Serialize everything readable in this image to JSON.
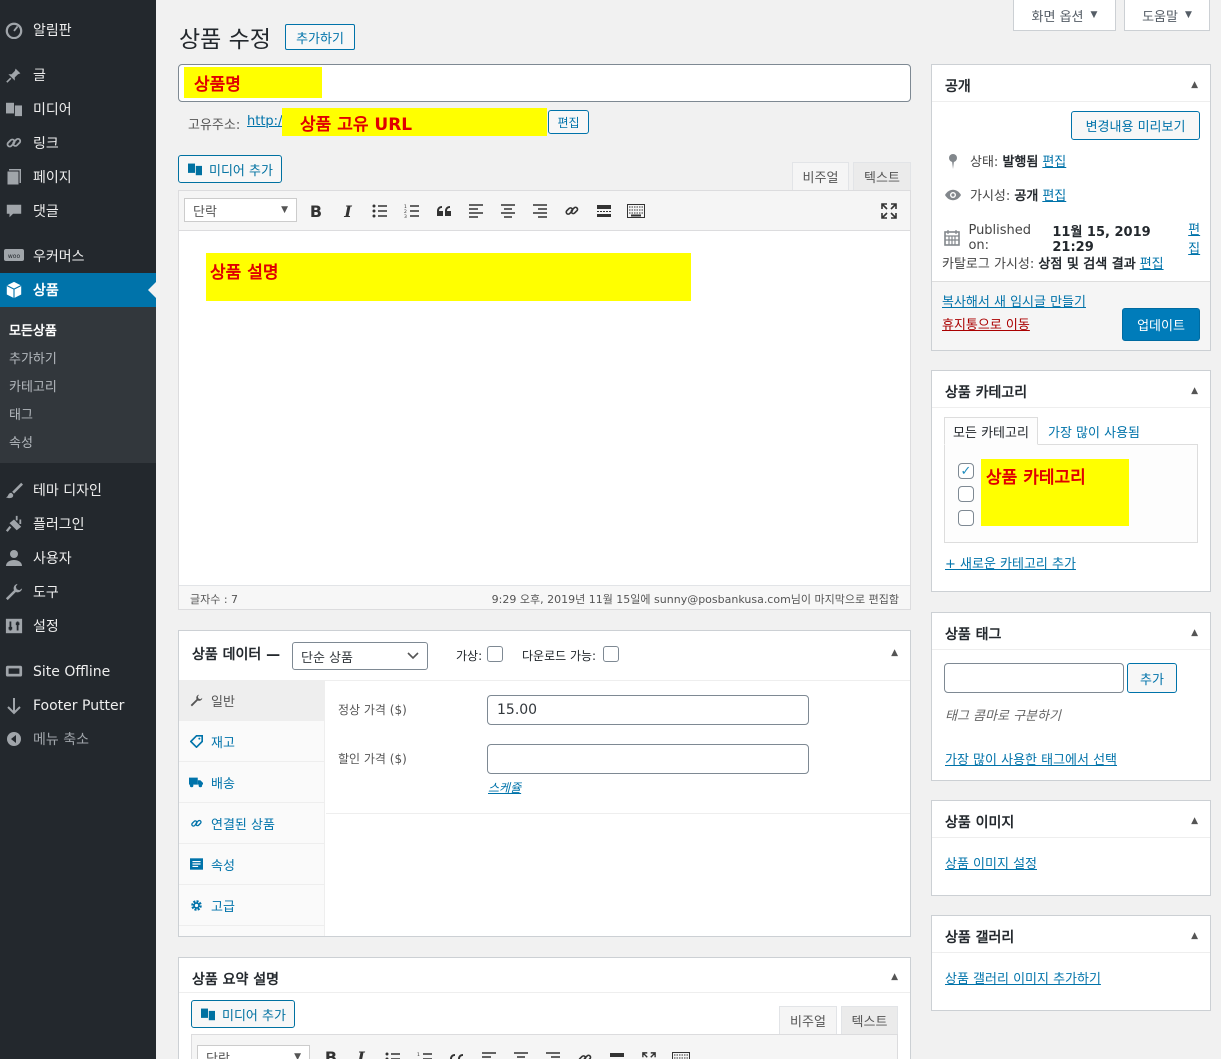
{
  "sidebar": {
    "items": [
      {
        "label": "알림판",
        "icon": "dashboard-icon"
      },
      {
        "label": "글",
        "icon": "pin-icon"
      },
      {
        "label": "미디어",
        "icon": "media-icon"
      },
      {
        "label": "링크",
        "icon": "link-icon"
      },
      {
        "label": "페이지",
        "icon": "page-icon"
      },
      {
        "label": "댓글",
        "icon": "comment-icon"
      },
      {
        "label": "우커머스",
        "icon": "woo-icon"
      },
      {
        "label": "상품",
        "icon": "box-icon"
      },
      {
        "label": "테마 디자인",
        "icon": "brush-icon"
      },
      {
        "label": "플러그인",
        "icon": "plug-icon"
      },
      {
        "label": "사용자",
        "icon": "user-icon"
      },
      {
        "label": "도구",
        "icon": "wrench-icon"
      },
      {
        "label": "설정",
        "icon": "sliders-icon"
      },
      {
        "label": "Site Offline",
        "icon": "offline-icon"
      },
      {
        "label": "Footer Putter",
        "icon": "arrow-down-icon"
      },
      {
        "label": "메뉴 축소",
        "icon": "collapse-icon"
      }
    ],
    "submenu": [
      "모든상품",
      "추가하기",
      "카테고리",
      "태그",
      "속성"
    ]
  },
  "screen_meta": {
    "screen_options": "화면 옵션",
    "help": "도움말"
  },
  "header": {
    "title": "상품 수정",
    "add_new": "추가하기"
  },
  "post": {
    "title_placeholder_highlight": "상품명",
    "permalink_label": "고유주소:",
    "permalink_url": "http://",
    "permalink_highlight": "상품 고유 URL",
    "permalink_edit": "편집"
  },
  "editor": {
    "add_media": "미디어 추가",
    "tab_visual": "비주얼",
    "tab_text": "텍스트",
    "format_select": "단락",
    "content_highlight": "상품 설명",
    "word_count": "글자수 : 7",
    "last_edit": "9:29 오후, 2019년 11월 15일에 sunny@posbankusa.com님이 마지막으로 편집함"
  },
  "product_data": {
    "title": "상품 데이터 —",
    "type_select": "단순 상품",
    "virtual_label": "가상:",
    "downloadable_label": "다운로드 가능:",
    "tabs": [
      {
        "label": "일반",
        "icon": "wrench-icon"
      },
      {
        "label": "재고",
        "icon": "tag-icon"
      },
      {
        "label": "배송",
        "icon": "truck-icon"
      },
      {
        "label": "연결된 상품",
        "icon": "link-icon"
      },
      {
        "label": "속성",
        "icon": "list-icon"
      },
      {
        "label": "고급",
        "icon": "gear-icon"
      }
    ],
    "regular_price_label": "정상 가격 ($)",
    "regular_price_value": "15.00",
    "sale_price_label": "할인 가격 ($)",
    "sale_price_value": "",
    "schedule_link": "스케쥴"
  },
  "short_description": {
    "title": "상품 요약 설명",
    "add_media": "미디어 추가",
    "tab_visual": "비주얼",
    "tab_text": "텍스트",
    "format_select": "단락"
  },
  "publish": {
    "title": "공개",
    "preview_button": "변경내용 미리보기",
    "status_label": "상태:",
    "status_value": "발행됨",
    "visibility_label": "가시성:",
    "visibility_value": "공개",
    "published_label": "Published on:",
    "published_value": "11월 15, 2019 21:29",
    "catalog_label": "카탈로그 가시성:",
    "catalog_value": "상점 및 검색 결과",
    "edit_link": "편집",
    "copy_draft": "복사해서 새 임시글 만들기",
    "trash": "휴지통으로 이동",
    "update_button": "업데이트"
  },
  "categories": {
    "title": "상품 카테고리",
    "tab_all": "모든 카테고리",
    "tab_popular": "가장 많이 사용됨",
    "highlight": "상품 카테고리",
    "checkboxes": [
      true,
      false,
      false
    ],
    "add_new": "+ 새로운 카테고리 추가"
  },
  "tags": {
    "title": "상품 태그",
    "input_value": "",
    "add_button": "추가",
    "hint": "태그 콤마로 구분하기",
    "choose_link": "가장 많이 사용한 태그에서 선택"
  },
  "product_image": {
    "title": "상품 이미지",
    "link": "상품 이미지 설정"
  },
  "gallery": {
    "title": "상품 갤러리",
    "link": "상품 갤러리 이미지 추가하기"
  },
  "colors": {
    "sidebar": "#23282d",
    "accent": "#0073aa",
    "highlight": "#ffff00",
    "highlight_text": "#e00000",
    "trash": "#a00"
  }
}
